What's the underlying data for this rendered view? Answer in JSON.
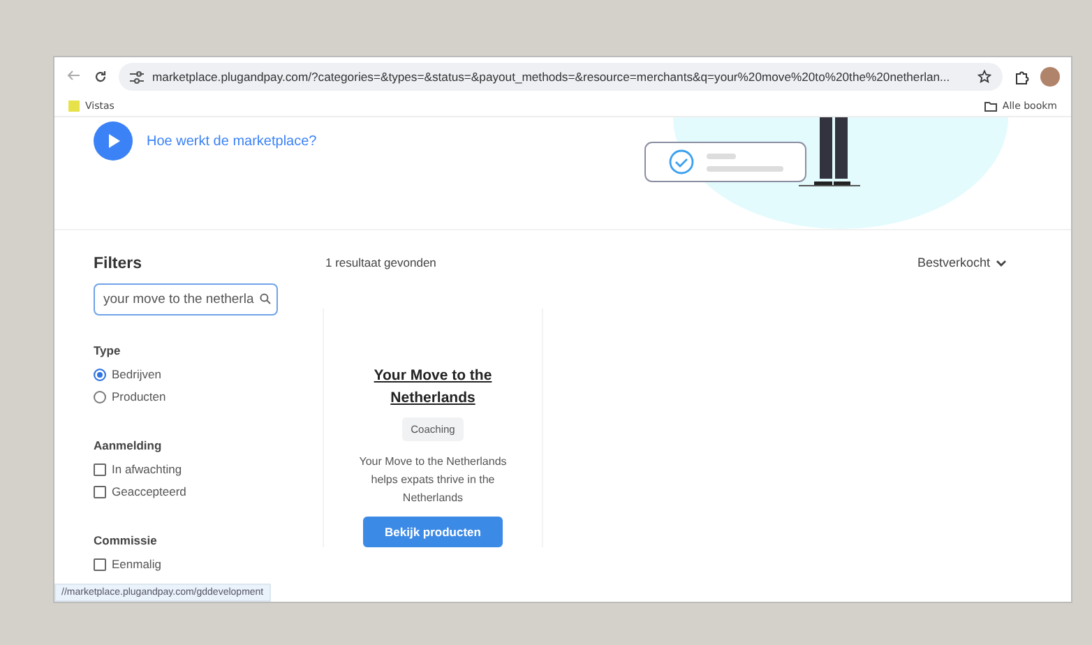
{
  "browser": {
    "url": "marketplace.plugandpay.com/?categories=&types=&status=&payout_methods=&resource=merchants&q=your%20move%20to%20the%20netherlan...",
    "bookmarks": [
      {
        "label": "Vistas"
      }
    ],
    "bookmarks_folder": "Alle bookm",
    "status_url": "//marketplace.plugandpay.com/gddevelopment"
  },
  "hero": {
    "link": "Hoe werkt de marketplace?"
  },
  "filters": {
    "title": "Filters",
    "search": {
      "value": "your move to the netherla"
    },
    "groups": [
      {
        "title": "Type",
        "kind": "radio",
        "options": [
          {
            "label": "Bedrijven",
            "selected": true
          },
          {
            "label": "Producten",
            "selected": false
          }
        ]
      },
      {
        "title": "Aanmelding",
        "kind": "checkbox",
        "options": [
          {
            "label": "In afwachting",
            "selected": false
          },
          {
            "label": "Geaccepteerd",
            "selected": false
          }
        ]
      },
      {
        "title": "Commissie",
        "kind": "checkbox",
        "options": [
          {
            "label": "Eenmalig",
            "selected": false
          }
        ]
      }
    ]
  },
  "results": {
    "count": "1 resultaat gevonden",
    "sort": "Bestverkocht",
    "cards": [
      {
        "title": "Your Move to the Netherlands",
        "tag": "Coaching",
        "description": "Your Move to the Netherlands helps expats thrive in the Netherlands",
        "button": "Bekijk producten"
      }
    ]
  }
}
